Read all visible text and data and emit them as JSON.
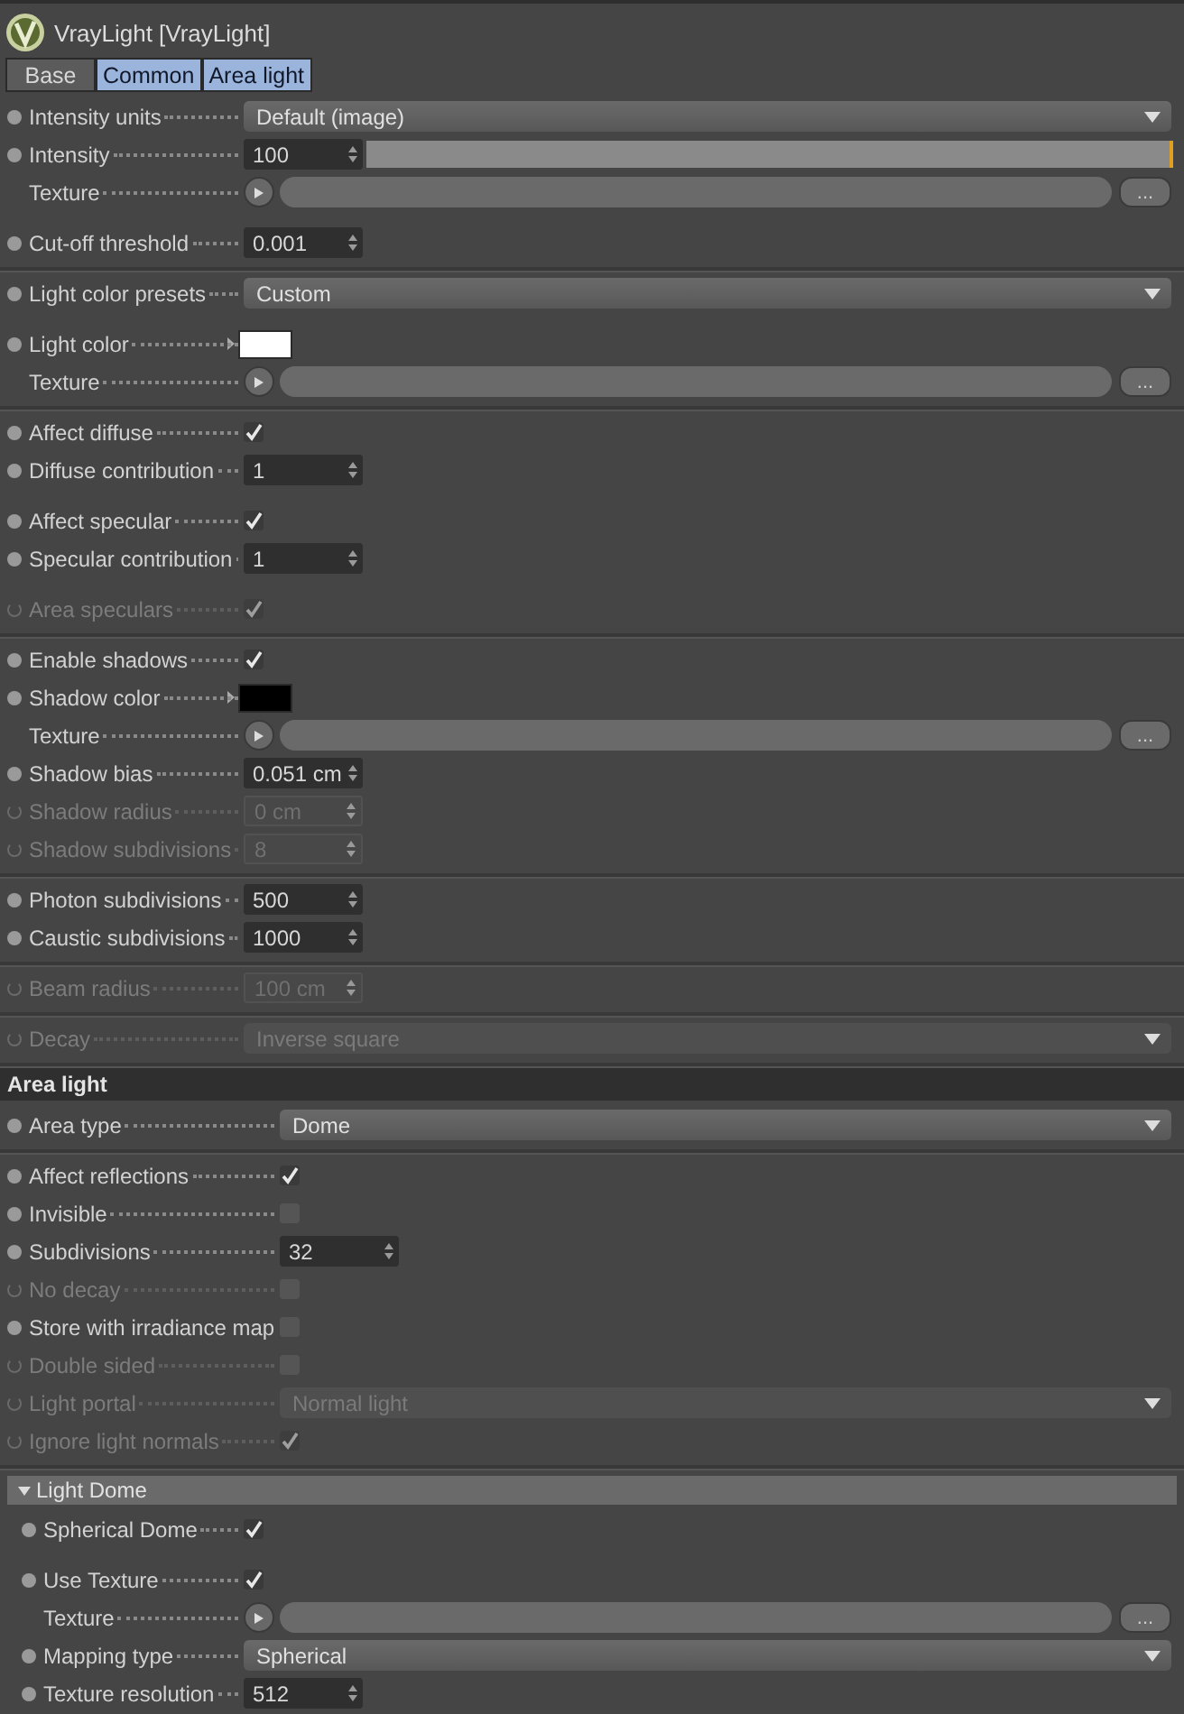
{
  "window": {
    "title": "VrayLight [VrayLight]"
  },
  "tabs": [
    {
      "label": "Base",
      "selected": false
    },
    {
      "label": "Common",
      "selected": true
    },
    {
      "label": "Area light",
      "selected": true
    }
  ],
  "sections": [
    {
      "kind": "plain",
      "groups": [
        {
          "blocks": [
            {
              "rows": [
                {
                  "kind": "dropdown",
                  "label": "Intensity units",
                  "dot": true,
                  "disabled": false,
                  "value": "Default (image)"
                },
                {
                  "kind": "slider",
                  "label": "Intensity",
                  "dot": true,
                  "disabled": false,
                  "value": "100",
                  "level": 1
                },
                {
                  "kind": "texture",
                  "label": "Texture",
                  "dot": false,
                  "disabled": false,
                  "button": "..."
                }
              ]
            },
            {
              "rows": [
                {
                  "kind": "number",
                  "label": "Cut-off threshold",
                  "dot": true,
                  "disabled": false,
                  "value": "0.001"
                }
              ]
            }
          ]
        },
        {
          "blocks": [
            {
              "rows": [
                {
                  "kind": "dropdown",
                  "label": "Light color presets",
                  "dot": true,
                  "disabled": false,
                  "value": "Custom"
                }
              ]
            },
            {
              "rows": [
                {
                  "kind": "color",
                  "label": "Light color",
                  "dot": true,
                  "disabled": false,
                  "color": "#ffffff"
                },
                {
                  "kind": "texture",
                  "label": "Texture",
                  "dot": false,
                  "disabled": false,
                  "button": "..."
                }
              ]
            }
          ]
        },
        {
          "blocks": [
            {
              "rows": [
                {
                  "kind": "checkbox",
                  "label": "Affect diffuse",
                  "dot": true,
                  "disabled": false,
                  "checked": true
                },
                {
                  "kind": "number",
                  "label": "Diffuse contribution",
                  "dot": true,
                  "disabled": false,
                  "value": "1"
                }
              ]
            },
            {
              "rows": [
                {
                  "kind": "checkbox",
                  "label": "Affect specular",
                  "dot": true,
                  "disabled": false,
                  "checked": true
                },
                {
                  "kind": "number",
                  "label": "Specular contribution",
                  "dot": true,
                  "disabled": false,
                  "value": "1"
                }
              ]
            },
            {
              "rows": [
                {
                  "kind": "checkbox",
                  "label": "Area speculars",
                  "dot": true,
                  "disabled": true,
                  "checked": true
                }
              ]
            }
          ]
        },
        {
          "blocks": [
            {
              "rows": [
                {
                  "kind": "checkbox",
                  "label": "Enable shadows",
                  "dot": true,
                  "disabled": false,
                  "checked": true
                },
                {
                  "kind": "color",
                  "label": "Shadow color",
                  "dot": true,
                  "disabled": false,
                  "color": "#000000"
                },
                {
                  "kind": "texture",
                  "label": "Texture",
                  "dot": false,
                  "disabled": false,
                  "button": "..."
                },
                {
                  "kind": "number",
                  "label": "Shadow bias",
                  "dot": true,
                  "disabled": false,
                  "value": "0.051 cm"
                },
                {
                  "kind": "number",
                  "label": "Shadow radius",
                  "dot": true,
                  "disabled": true,
                  "value": "0 cm"
                },
                {
                  "kind": "number",
                  "label": "Shadow subdivisions",
                  "dot": true,
                  "disabled": true,
                  "value": "8"
                }
              ]
            }
          ]
        },
        {
          "blocks": [
            {
              "rows": [
                {
                  "kind": "number",
                  "label": "Photon subdivisions",
                  "dot": true,
                  "disabled": false,
                  "value": "500"
                },
                {
                  "kind": "number",
                  "label": "Caustic subdivisions",
                  "dot": true,
                  "disabled": false,
                  "value": "1000"
                }
              ]
            }
          ]
        },
        {
          "blocks": [
            {
              "rows": [
                {
                  "kind": "number",
                  "label": "Beam radius",
                  "dot": true,
                  "disabled": true,
                  "value": "100 cm"
                }
              ]
            }
          ]
        },
        {
          "blocks": [
            {
              "rows": [
                {
                  "kind": "dropdown",
                  "label": "Decay",
                  "dot": true,
                  "disabled": true,
                  "value": "Inverse square"
                }
              ]
            }
          ]
        }
      ]
    },
    {
      "kind": "header",
      "title": "Area light",
      "groups": [
        {
          "blocks": [
            {
              "rows": [
                {
                  "kind": "dropdown",
                  "label": "Area type",
                  "dot": true,
                  "disabled": false,
                  "value": "Dome"
                }
              ]
            }
          ]
        },
        {
          "blocks": [
            {
              "rows": [
                {
                  "kind": "checkbox",
                  "label": "Affect reflections",
                  "dot": true,
                  "disabled": false,
                  "checked": true
                },
                {
                  "kind": "checkbox",
                  "label": "Invisible",
                  "dot": true,
                  "disabled": false,
                  "checked": false
                },
                {
                  "kind": "number",
                  "label": "Subdivisions",
                  "dot": true,
                  "disabled": false,
                  "value": "32"
                },
                {
                  "kind": "checkbox",
                  "label": "No decay",
                  "dot": true,
                  "disabled": true,
                  "checked": false
                },
                {
                  "kind": "checkbox",
                  "label": "Store with irradiance map",
                  "dot": true,
                  "disabled": false,
                  "checked": false
                },
                {
                  "kind": "checkbox",
                  "label": "Double sided",
                  "dot": true,
                  "disabled": true,
                  "checked": false
                },
                {
                  "kind": "dropdown",
                  "label": "Light portal",
                  "dot": true,
                  "disabled": true,
                  "value": "Normal light"
                },
                {
                  "kind": "checkbox",
                  "label": "Ignore light normals",
                  "dot": true,
                  "disabled": true,
                  "checked": true
                }
              ]
            }
          ]
        }
      ]
    },
    {
      "kind": "group",
      "title": "Light Dome",
      "expanded": true,
      "groups": [
        {
          "blocks": [
            {
              "rows": [
                {
                  "kind": "checkbox",
                  "label": "Spherical Dome",
                  "dot": true,
                  "disabled": false,
                  "checked": true
                }
              ]
            },
            {
              "rows": [
                {
                  "kind": "checkbox",
                  "label": "Use Texture",
                  "dot": true,
                  "disabled": false,
                  "checked": true
                },
                {
                  "kind": "texture",
                  "label": "Texture",
                  "dot": false,
                  "disabled": false,
                  "button": "..."
                },
                {
                  "kind": "dropdown",
                  "label": "Mapping type",
                  "dot": true,
                  "disabled": false,
                  "value": "Spherical"
                },
                {
                  "kind": "number",
                  "label": "Texture resolution",
                  "dot": true,
                  "disabled": false,
                  "value": "512"
                }
              ]
            }
          ]
        }
      ]
    }
  ]
}
